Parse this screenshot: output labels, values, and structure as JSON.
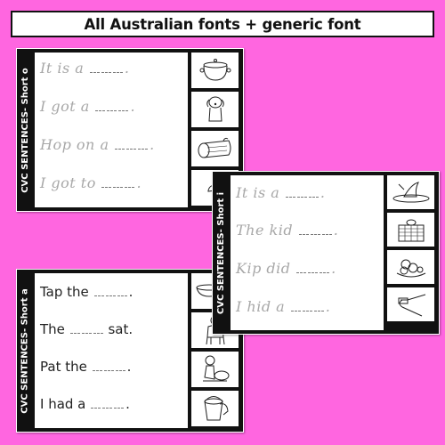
{
  "banner": {
    "title": "All Australian fonts + generic font"
  },
  "colors": {
    "background": "#ff66e0",
    "card": "#111111"
  },
  "cards": [
    {
      "id": "short-o",
      "side_label": "CVC SENTENCES- Short o",
      "font_style": "cursive-tracing",
      "sentences": [
        {
          "prefix": "It is a",
          "suffix": "."
        },
        {
          "prefix": "I got a",
          "suffix": "."
        },
        {
          "prefix": "Hop on a",
          "suffix": "."
        },
        {
          "prefix": "I got to",
          "suffix": "."
        }
      ],
      "pictures": [
        "pot",
        "dog",
        "log",
        "partial-image"
      ]
    },
    {
      "id": "short-i",
      "side_label": "CVC SENTENCES- Short i",
      "font_style": "cursive-tracing",
      "sentences": [
        {
          "prefix": "It is a",
          "suffix": "."
        },
        {
          "prefix": "The kid",
          "suffix": "."
        },
        {
          "prefix": "Kip did",
          "suffix": "."
        },
        {
          "prefix": "I hid a",
          "suffix": "."
        }
      ],
      "pictures": [
        "fin",
        "bricks-wall",
        "figs",
        "pin"
      ]
    },
    {
      "id": "short-a",
      "side_label": "CVC SENTENCES- Short a",
      "font_style": "generic-tracing",
      "sentences": [
        {
          "prefix": "Tap the",
          "suffix": "."
        },
        {
          "prefix": "The",
          "suffix": "sat."
        },
        {
          "prefix": "Pat the",
          "suffix": "."
        },
        {
          "prefix": "I had a",
          "suffix": "."
        }
      ],
      "pictures": [
        "pan",
        "man",
        "cat",
        "bucket-rag"
      ]
    }
  ]
}
